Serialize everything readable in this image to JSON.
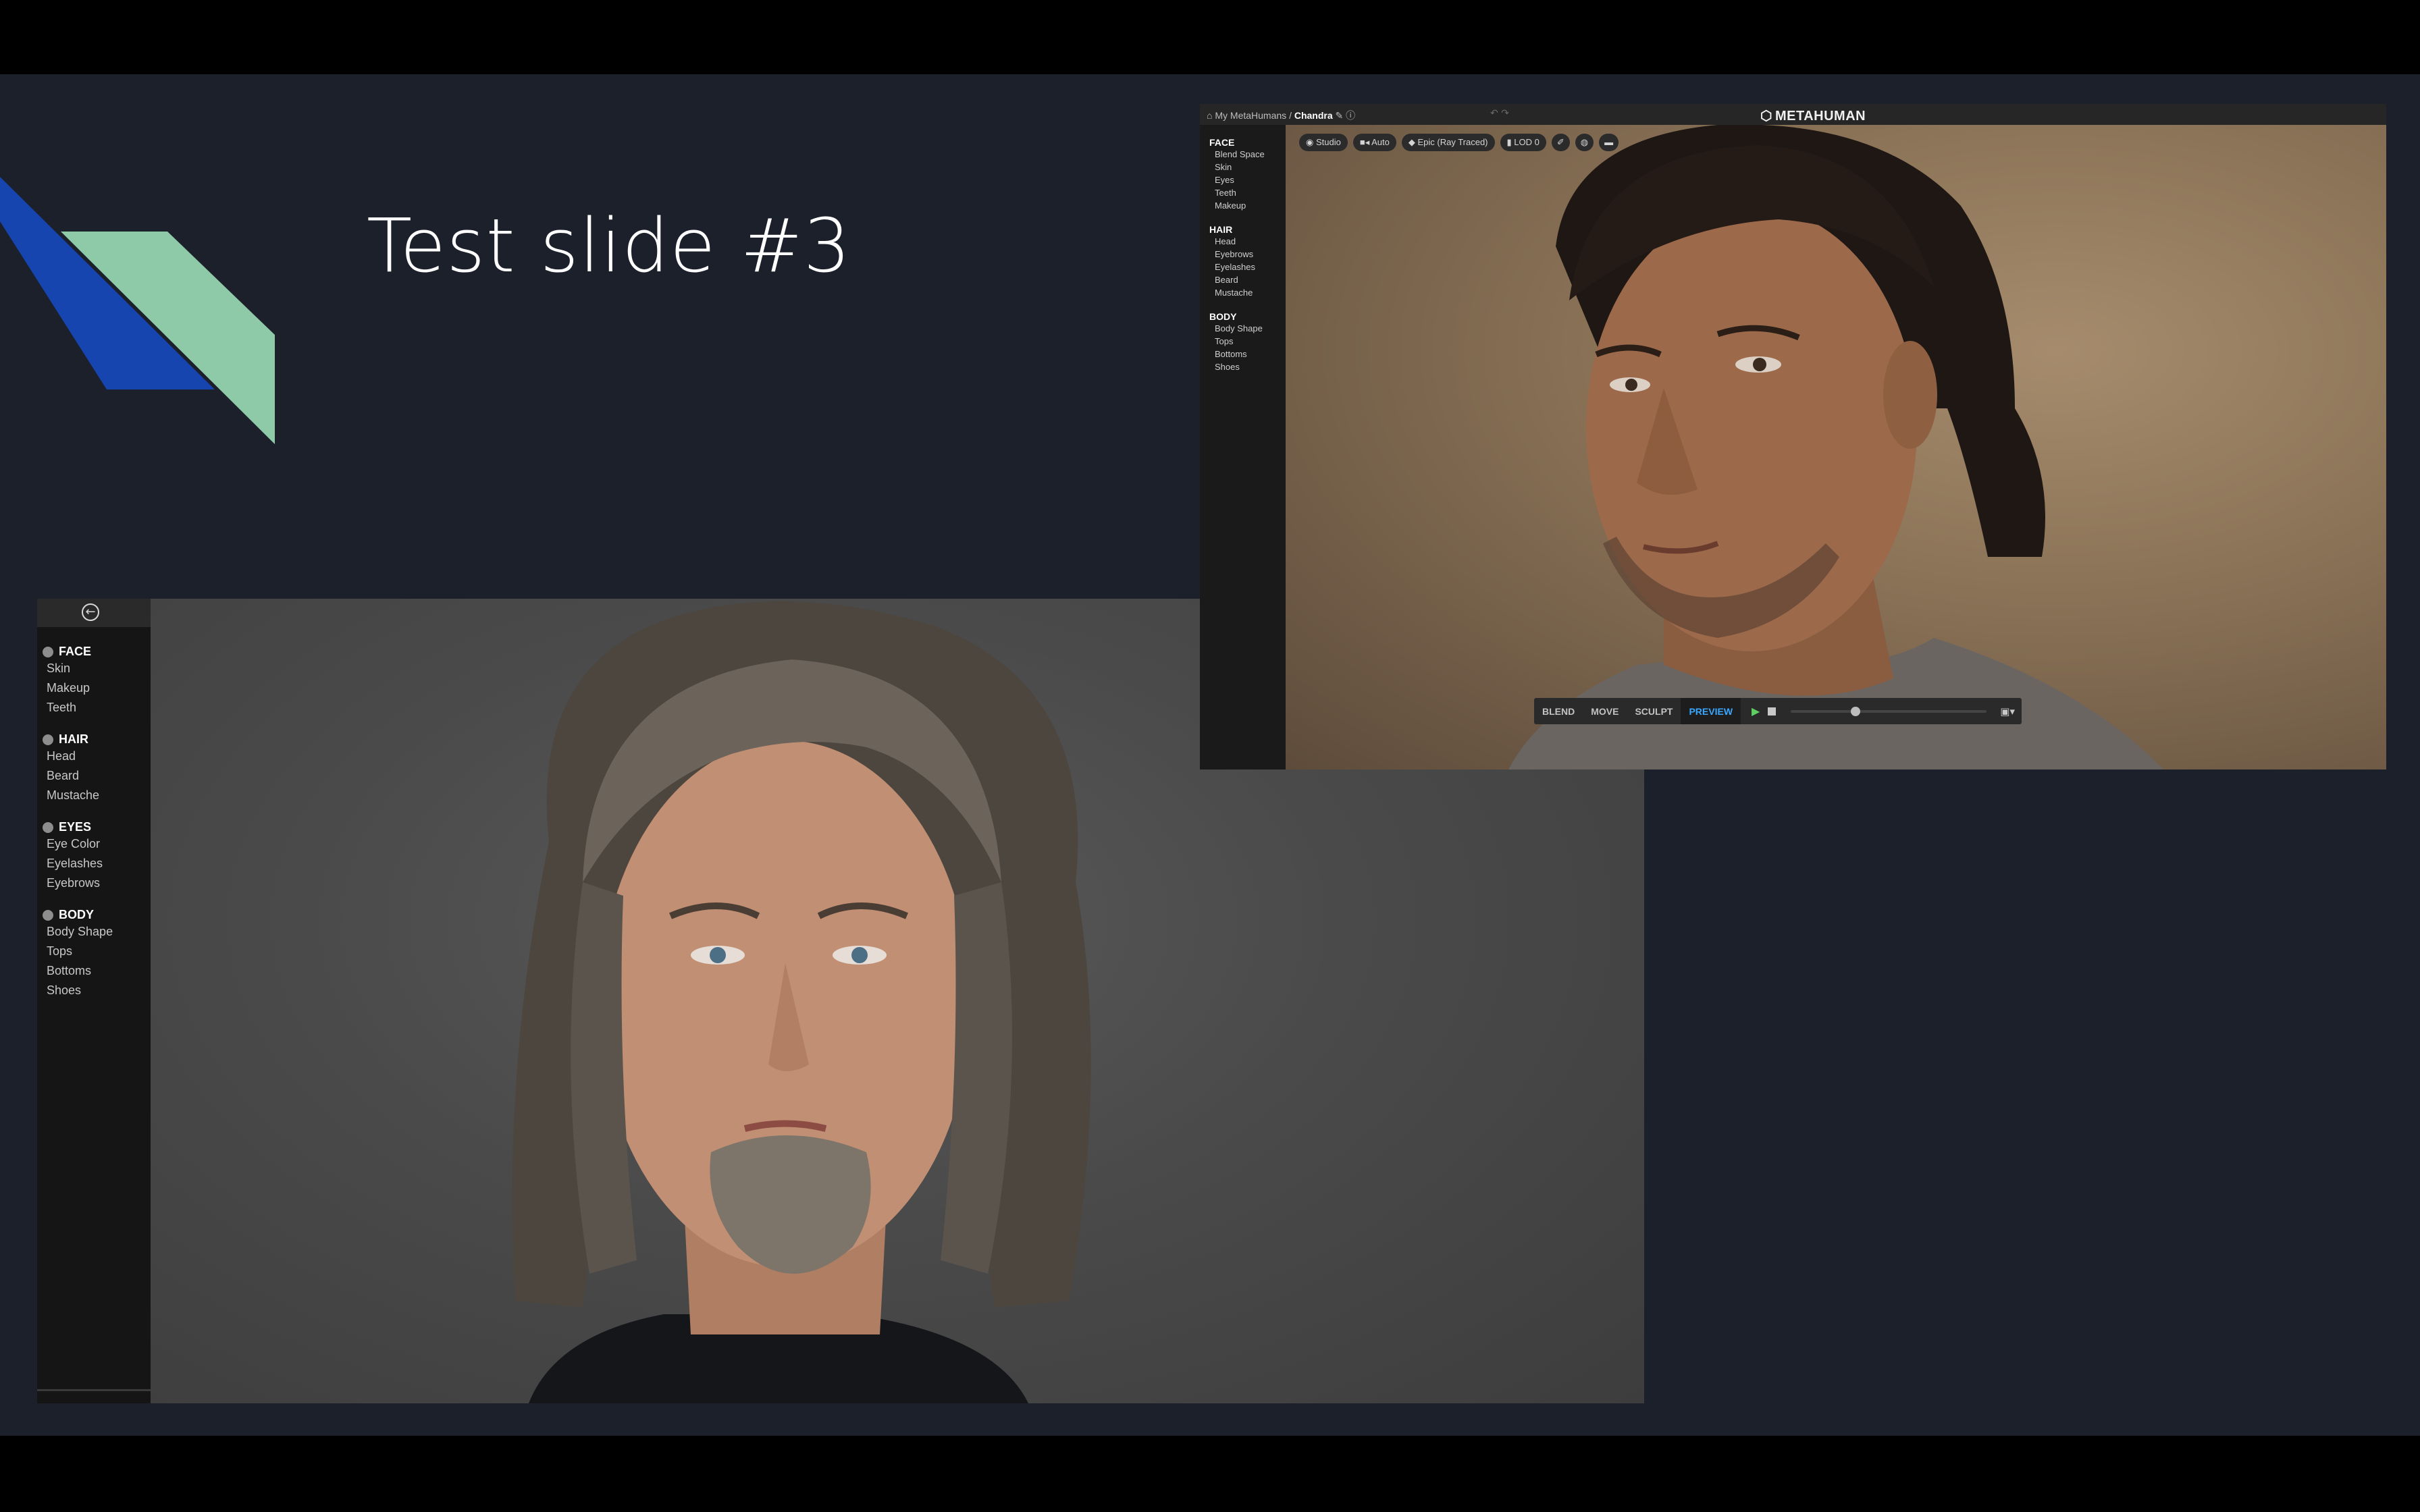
{
  "slide": {
    "title": "Test slide #3",
    "colors": {
      "background": "#1c202b",
      "accent_blue": "#1745b0",
      "accent_green": "#8ec9a8"
    }
  },
  "screenshot_1": {
    "back_icon": "arrow-left-circle-icon",
    "sections": [
      {
        "icon": "face-icon",
        "label": "FACE",
        "items": [
          "Skin",
          "Makeup",
          "Teeth"
        ]
      },
      {
        "icon": "hair-icon",
        "label": "HAIR",
        "items": [
          "Head",
          "Beard",
          "Mustache"
        ]
      },
      {
        "icon": "eye-icon",
        "label": "EYES",
        "items": [
          "Eye Color",
          "Eyelashes",
          "Eyebrows"
        ]
      },
      {
        "icon": "body-icon",
        "label": "BODY",
        "items": [
          "Body Shape",
          "Tops",
          "Bottoms",
          "Shoes"
        ]
      }
    ]
  },
  "screenshot_2": {
    "breadcrumb": {
      "root": "My MetaHumans",
      "separator": "/",
      "current": "Chandra"
    },
    "logo_text": "METAHUMAN",
    "sections": [
      {
        "label": "FACE",
        "items": [
          "Blend Space",
          "Skin",
          "Eyes",
          "Teeth",
          "Makeup"
        ]
      },
      {
        "label": "HAIR",
        "items": [
          "Head",
          "Eyebrows",
          "Eyelashes",
          "Beard",
          "Mustache"
        ]
      },
      {
        "label": "BODY",
        "items": [
          "Body Shape",
          "Tops",
          "Bottoms",
          "Shoes"
        ]
      }
    ],
    "toolbar": {
      "lighting": "Studio",
      "camera": "Auto",
      "quality": "Epic (Ray Traced)",
      "lod": "LOD 0"
    },
    "modes": [
      "BLEND",
      "MOVE",
      "SCULPT",
      "PREVIEW"
    ],
    "active_mode": "PREVIEW",
    "timeline_position": 0.33
  }
}
